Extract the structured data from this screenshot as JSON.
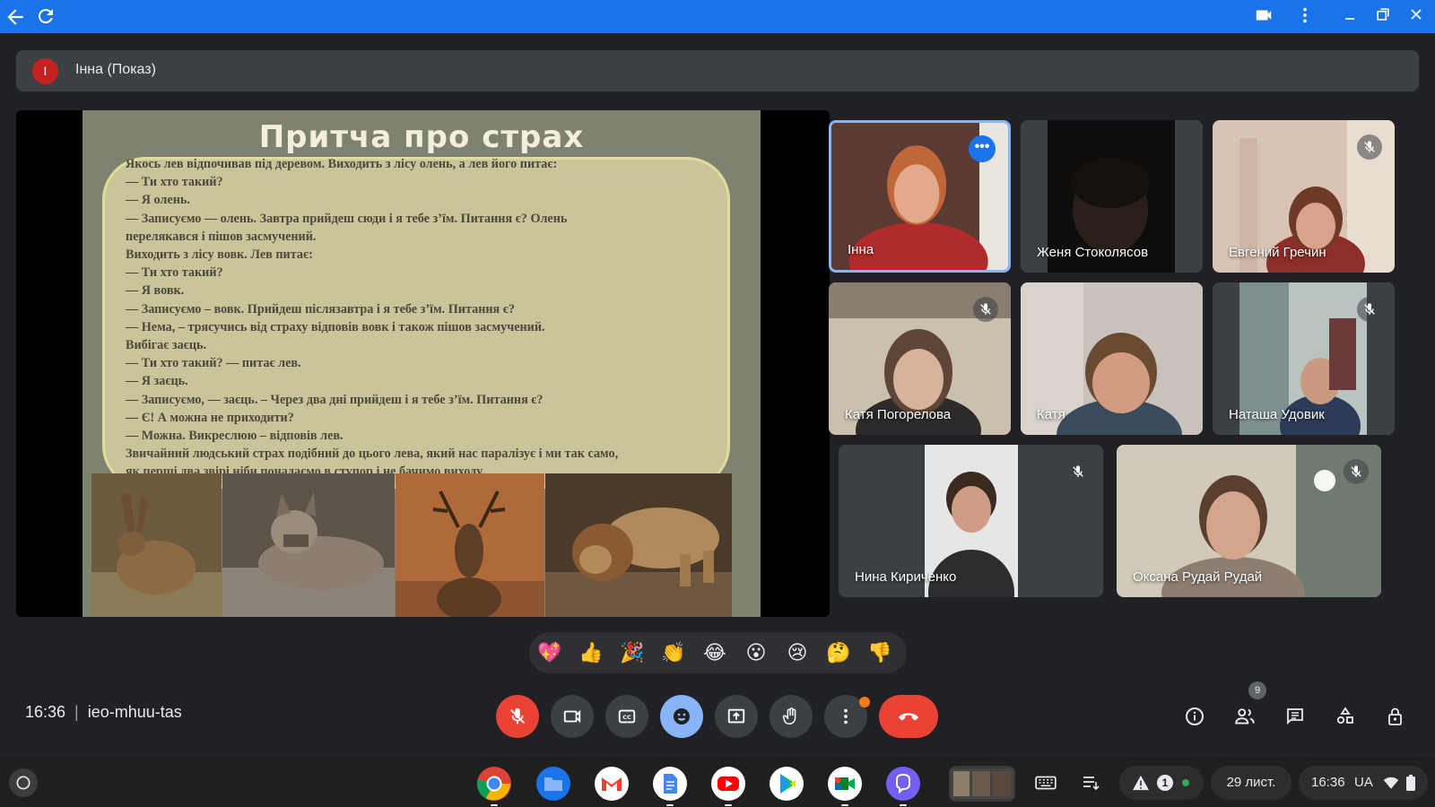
{
  "window": {
    "accent": "#1a73e8"
  },
  "banner": {
    "avatar_letter": "І",
    "presenter_label": "Інна (Показ)"
  },
  "slide": {
    "title": "Притча про страх",
    "lines": [
      "Якось лев відпочивав під деревом. Виходить з лісу олень, а лев його питає:",
      "— Ти хто такий?",
      "— Я олень.",
      "— Записуємо — олень. Завтра прийдеш сюди і я тебе з’їм. Питання є? Олень",
      "перелякався і пішов засмучений.",
      "Виходить з лісу вовк. Лев питає:",
      "— Ти хто такий?",
      "— Я вовк.",
      "— Записуємо – вовк. Прийдеш післязавтра і я тебе з’їм. Питання є?",
      "— Нема, – трясучись від страху відповів вовк і також пішов засмучений.",
      "Вибігає заєць.",
      "— Ти хто такий? — питає лев.",
      "— Я заєць.",
      "— Записуємо, — заєць. – Через два дні прийдеш і я тебе з’їм. Питання є?",
      "— Є! А можна не приходити?",
      "— Можна. Викреслюю – відповів лев.",
      "Звичайний людський страх подібний до цього лева, який нас паралізує і ми так само,",
      "як перші два звірі ніби понадаємо в ступор і не бачимо виходу."
    ]
  },
  "participants": [
    {
      "name": "Інна",
      "active": true,
      "muted": false
    },
    {
      "name": "Женя Стоколясов",
      "active": false,
      "muted": false
    },
    {
      "name": "Евгений Гречин",
      "active": false,
      "muted": true
    },
    {
      "name": "Катя Погорелова",
      "active": false,
      "muted": true
    },
    {
      "name": "Катя",
      "active": false,
      "muted": false
    },
    {
      "name": "Наташа Удовик",
      "active": false,
      "muted": true
    },
    {
      "name": "Нина Кириченко",
      "active": false,
      "muted": true
    },
    {
      "name": "Оксана Рудай Рудай",
      "active": false,
      "muted": true
    }
  ],
  "reactions": [
    "💖",
    "👍",
    "🎉",
    "👏",
    "😂",
    "😮",
    "😢",
    "🤔",
    "👎"
  ],
  "meeting": {
    "time": "16:36",
    "code": "ieo-mhuu-tas",
    "participant_count": "9"
  },
  "controls": [
    "microphone-off-icon",
    "camera-icon",
    "captions-icon",
    "emoji-icon",
    "present-screen-icon",
    "raise-hand-icon",
    "more-options-icon",
    "hang-up-icon"
  ],
  "shelf": {
    "date": "29 лист.",
    "time": "16:36",
    "region": "UA",
    "notification_count": "1"
  }
}
